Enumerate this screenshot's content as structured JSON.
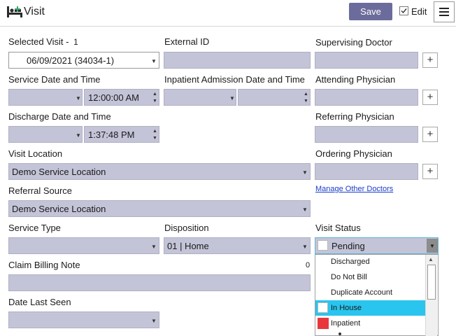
{
  "header": {
    "title": "Visit",
    "save_label": "Save",
    "edit_label": "Edit",
    "edit_checked": true,
    "accent": "#6c6c9c"
  },
  "form": {
    "selected_visit_label": "Selected Visit -",
    "selected_visit_count": "1",
    "selected_visit_value": "06/09/2021 (34034-1)",
    "external_id_label": "External ID",
    "supervising_doctor_label": "Supervising Doctor",
    "service_datetime_label": "Service Date and Time",
    "service_time_value": "12:00:00 AM",
    "inpatient_admission_label": "Inpatient Admission Date and Time",
    "attending_physician_label": "Attending Physician",
    "discharge_datetime_label": "Discharge Date and Time",
    "discharge_time_value": "1:37:48 PM",
    "referring_physician_label": "Referring Physician",
    "visit_location_label": "Visit Location",
    "visit_location_value": "Demo Service Location",
    "ordering_physician_label": "Ordering Physician",
    "referral_source_label": "Referral Source",
    "referral_source_value": "Demo Service Location",
    "manage_doctors_link": "Manage Other Doctors",
    "service_type_label": "Service Type",
    "disposition_label": "Disposition",
    "disposition_value": "01 | Home",
    "visit_status_label": "Visit Status",
    "visit_status_value": "Pending",
    "claim_billing_note_label": "Claim Billing Note",
    "claim_billing_note_count": "0",
    "date_last_seen_label": "Date Last Seen",
    "plus_label": "+"
  },
  "status_dropdown": {
    "options": [
      {
        "label": "Discharged",
        "swatch": "none"
      },
      {
        "label": "Do Not Bill",
        "swatch": "none"
      },
      {
        "label": "Duplicate Account",
        "swatch": "none"
      },
      {
        "label": "In House",
        "swatch": "#ffffff",
        "highlighted": true
      },
      {
        "label": "Inpatient",
        "swatch": "#e8363c"
      }
    ],
    "highlight_color": "#29c5ee"
  },
  "icons": {
    "title": "bed-icon",
    "menu": "hamburger-menu-icon"
  }
}
